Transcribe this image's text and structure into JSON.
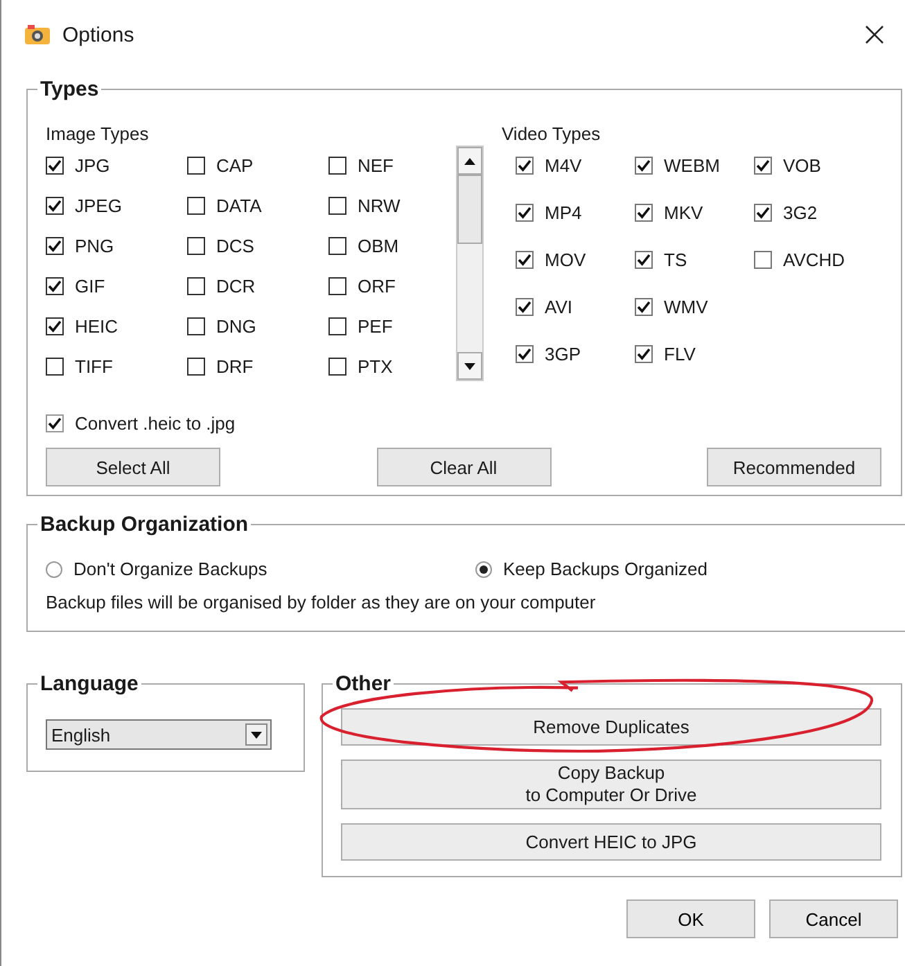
{
  "window": {
    "title": "Options"
  },
  "types": {
    "title": "Types",
    "image_types": {
      "label": "Image Types",
      "columns": [
        [
          {
            "label": "JPG",
            "checked": true
          },
          {
            "label": "JPEG",
            "checked": true
          },
          {
            "label": "PNG",
            "checked": true
          },
          {
            "label": "GIF",
            "checked": true
          },
          {
            "label": "HEIC",
            "checked": true
          },
          {
            "label": "TIFF",
            "checked": false
          }
        ],
        [
          {
            "label": "CAP",
            "checked": false
          },
          {
            "label": "DATA",
            "checked": false
          },
          {
            "label": "DCS",
            "checked": false
          },
          {
            "label": "DCR",
            "checked": false
          },
          {
            "label": "DNG",
            "checked": false
          },
          {
            "label": "DRF",
            "checked": false
          }
        ],
        [
          {
            "label": "NEF",
            "checked": false
          },
          {
            "label": "NRW",
            "checked": false
          },
          {
            "label": "OBM",
            "checked": false
          },
          {
            "label": "ORF",
            "checked": false
          },
          {
            "label": "PEF",
            "checked": false
          },
          {
            "label": "PTX",
            "checked": false
          }
        ]
      ]
    },
    "video_types": {
      "label": "Video Types",
      "columns": [
        [
          {
            "label": "M4V",
            "checked": true
          },
          {
            "label": "MP4",
            "checked": true
          },
          {
            "label": "MOV",
            "checked": true
          },
          {
            "label": "AVI",
            "checked": true
          },
          {
            "label": "3GP",
            "checked": true
          }
        ],
        [
          {
            "label": "WEBM",
            "checked": true
          },
          {
            "label": "MKV",
            "checked": true
          },
          {
            "label": "TS",
            "checked": true
          },
          {
            "label": "WMV",
            "checked": true
          },
          {
            "label": "FLV",
            "checked": true
          }
        ],
        [
          {
            "label": "VOB",
            "checked": true
          },
          {
            "label": "3G2",
            "checked": true
          },
          {
            "label": "AVCHD",
            "checked": false
          }
        ]
      ]
    },
    "convert_heic": {
      "label": "Convert .heic to .jpg",
      "checked": true
    },
    "buttons": [
      "Select All",
      "Clear All",
      "Recommended"
    ]
  },
  "backup_organization": {
    "title": "Backup Organization",
    "options": [
      {
        "label": "Don't Organize Backups",
        "selected": false
      },
      {
        "label": "Keep Backups Organized",
        "selected": true
      }
    ],
    "note": "Backup files will be organised by folder as they are on your computer"
  },
  "language": {
    "title": "Language",
    "value": "English"
  },
  "other": {
    "title": "Other",
    "buttons": [
      "Remove Duplicates",
      "Copy Backup\nto Computer Or Drive",
      "Convert HEIC to JPG"
    ]
  },
  "buttons": [
    "OK",
    "Cancel"
  ]
}
